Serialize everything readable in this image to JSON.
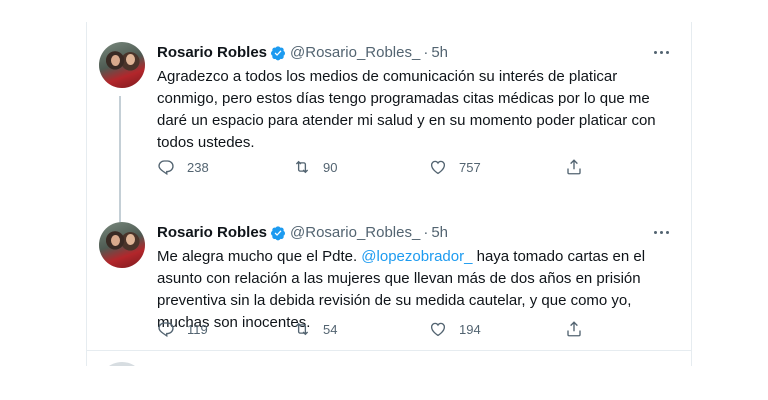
{
  "tweets": [
    {
      "name": "Rosario Robles",
      "handle": "@Rosario_Robles_",
      "separator": "·",
      "time": "5h",
      "text_parts": [
        "Agradezco a todos los medios de comunicación su interés de platicar conmigo, pero estos días tengo programadas citas médicas por lo que me daré un espacio para atender mi salud y en su momento poder platicar con todos ustedes."
      ],
      "replies": "238",
      "retweets": "90",
      "likes": "757"
    },
    {
      "name": "Rosario Robles",
      "handle": "@Rosario_Robles_",
      "separator": "·",
      "time": "5h",
      "text_before": "Me alegra mucho que el Pdte. ",
      "mention": "@lopezobrador_",
      "text_after": "  haya tomado cartas en el asunto con relación a las mujeres que llevan más de dos años en prisión preventiva sin la debida revisión de su medida cautelar, y que como yo, muchas son inocentes.",
      "replies": "119",
      "retweets": "54",
      "likes": "194"
    }
  ],
  "icons": {
    "verified": "verified-badge-icon",
    "reply": "reply-icon",
    "retweet": "retweet-icon",
    "like": "like-icon",
    "share": "share-icon",
    "more": "more-icon"
  },
  "colors": {
    "accent": "#1d9bf0",
    "text": "#0f1419",
    "secondary": "#536471",
    "border": "#e6ecf0"
  }
}
